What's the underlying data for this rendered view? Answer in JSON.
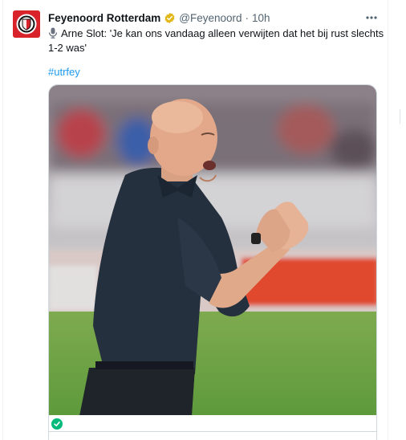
{
  "tweet": {
    "author_name": "Feyenoord Rotterdam",
    "handle": "@Feyenoord",
    "separator": "·",
    "time": "10h",
    "text_icon": "microphone-icon",
    "text": "Arne Slot: 'Je kan ons vandaag alleen verwijten dat het bij rust slechts 1-2 was'",
    "hashtag": "#utrfey",
    "verified_color": "#e2b719",
    "link_color": "#1d9bf0",
    "accent_color": "#d8232a"
  },
  "icons": {
    "avatar": "feyenoord-crest-icon",
    "verified": "verified-badge-icon",
    "more": "more-options-icon",
    "check": "check-circle-icon"
  }
}
